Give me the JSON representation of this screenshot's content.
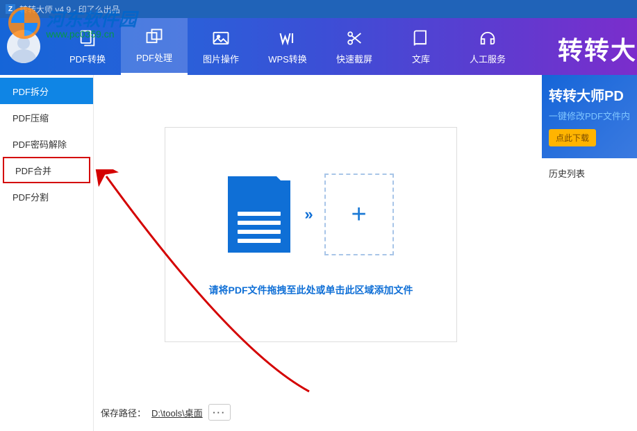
{
  "titlebar": {
    "app_icon_letter": "Z",
    "title": "转转大师 v4.9 - 印了么出品"
  },
  "watermark": {
    "cn": "河东软件园",
    "url": "www.pc0359.cn"
  },
  "topnav": {
    "items": [
      {
        "id": "pdf-convert",
        "label": "PDF转换"
      },
      {
        "id": "pdf-process",
        "label": "PDF处理"
      },
      {
        "id": "image-ops",
        "label": "图片操作"
      },
      {
        "id": "wps-convert",
        "label": "WPS转换"
      },
      {
        "id": "quick-screenshot",
        "label": "快速截屏"
      },
      {
        "id": "library",
        "label": "文库"
      },
      {
        "id": "manual-service",
        "label": "人工服务"
      }
    ],
    "active_index": 1,
    "brand": "转转大"
  },
  "sidebar": {
    "items": [
      {
        "id": "pdf-split",
        "label": "PDF拆分",
        "active": true
      },
      {
        "id": "pdf-compress",
        "label": "PDF压缩"
      },
      {
        "id": "pdf-password",
        "label": "PDF密码解除"
      },
      {
        "id": "pdf-merge",
        "label": "PDF合并",
        "highlighted": true
      },
      {
        "id": "pdf-cut",
        "label": "PDF分割"
      }
    ]
  },
  "dropzone": {
    "arrow_glyph": "»",
    "plus_glyph": "+",
    "hint": "请将PDF文件拖拽至此处或单击此区域添加文件"
  },
  "save": {
    "label": "保存路径：",
    "path": "D:\\tools\\桌面",
    "more": "···"
  },
  "rightpanel": {
    "promo_title": "转转大师PD",
    "promo_sub": "一键修改PDF文件内",
    "download_btn": "点此下载",
    "history_label": "历史列表"
  }
}
